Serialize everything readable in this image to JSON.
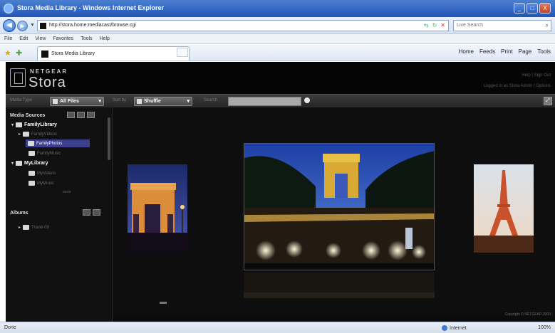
{
  "window": {
    "title": "Stora Media Library - Windows Internet Explorer",
    "controls": {
      "minimize": "_",
      "maximize": "□",
      "close": "X"
    }
  },
  "browser": {
    "back": "◀",
    "forward": "▶",
    "url": "http://stora.home:mediacast/browse.cgi",
    "search_placeholder": "Live Search",
    "menu": [
      "File",
      "Edit",
      "View",
      "Favorites",
      "Tools",
      "Help"
    ],
    "tab_label": "Stora Media Library",
    "commands": [
      "Home",
      "Feeds",
      "Print",
      "Page",
      "Tools"
    ],
    "status_left": "Done",
    "zone": "Internet",
    "zoom": "100%"
  },
  "app": {
    "brand": "NETGEAR",
    "product": "Stora",
    "header_links": [
      "Help | Sign Out",
      "Logged in as  Stora Admin  |  Options"
    ],
    "toolbar": {
      "view_label": "Media Type",
      "type_value": "All Files",
      "sort_label": "Sort by",
      "sort_value": "Shuffle",
      "search_label": "Search"
    },
    "sidebar": {
      "media_sources_title": "Media Sources",
      "albums_title": "Albums",
      "tree": [
        {
          "label": "FamilyLibrary",
          "level": 0,
          "style": "top"
        },
        {
          "label": "FamilyVideos",
          "level": 1,
          "style": "dim"
        },
        {
          "label": "FamilyPhotos",
          "level": 1,
          "style": "sel"
        },
        {
          "label": "FamilyMusic",
          "level": 1,
          "style": "dim"
        },
        {
          "label": "MyLibrary",
          "level": 0,
          "style": "top"
        },
        {
          "label": "MyVideos",
          "level": 1,
          "style": "dim"
        },
        {
          "label": "MyMusic",
          "level": 1,
          "style": "dim"
        }
      ],
      "more": "more",
      "album_item": "Travel 09"
    },
    "photos": [
      "Arc de Triomphe at dusk",
      "Champs-Élysées at night",
      "Eiffel Tower"
    ],
    "copyright": "Copyright © NETGEAR 2009"
  },
  "colors": {
    "selection": "#3b3f8e",
    "background": "#0c0c0c",
    "titlebar": "#2356b5"
  }
}
